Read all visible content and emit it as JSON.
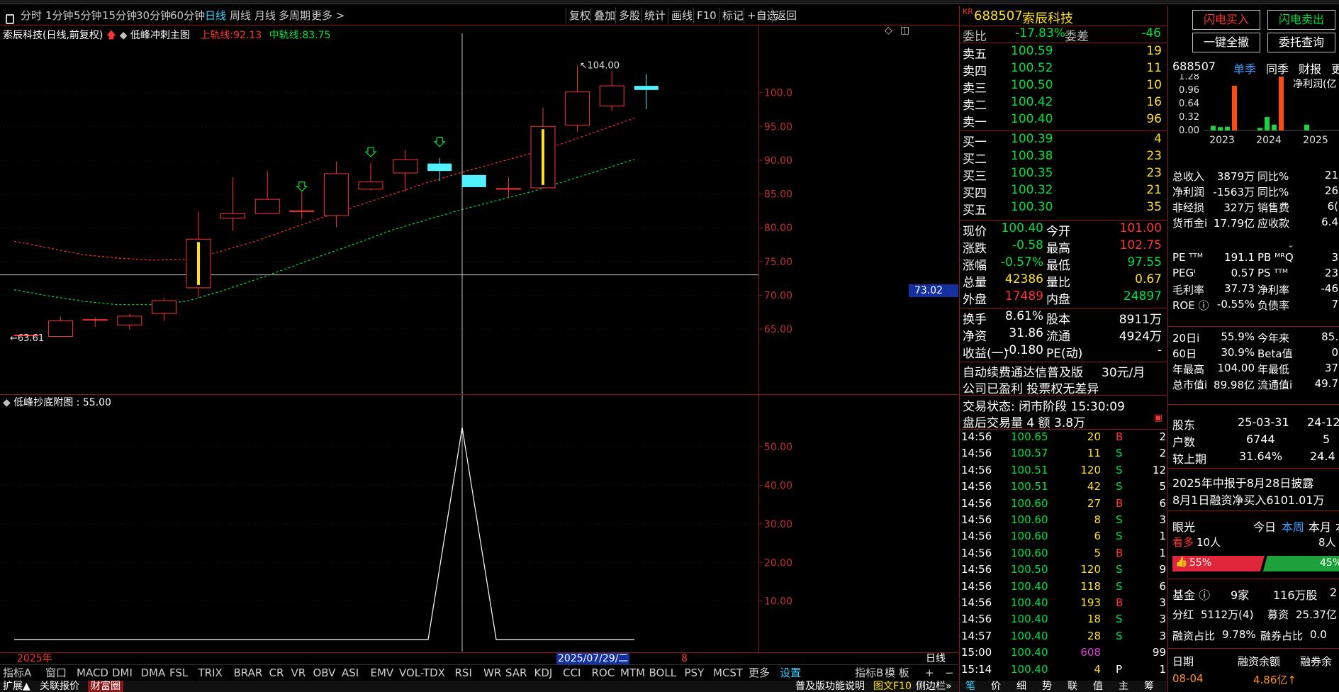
{
  "toolbar": {
    "items": [
      "分时",
      "1分钟",
      "5分钟",
      "15分钟",
      "30分钟",
      "60分钟",
      "日线",
      "周线",
      "月线",
      "多周期",
      "更多 >"
    ],
    "active": "日线",
    "right": [
      "复权",
      "叠加",
      "多股",
      "统计",
      "画线",
      "F10",
      "标记",
      "+自选",
      "返回"
    ]
  },
  "chart": {
    "title": "索辰科技(日线,前复权)",
    "indicator": "低峰冲刺主图",
    "upper_label": "上轨线:",
    "upper_value": "92.13",
    "mid_label": "中轨线:",
    "mid_value": "83.75",
    "high_marker": "104.00",
    "low_marker": "63.61",
    "crosshair_value": "73.02",
    "year_label": "2025年",
    "crosshair_date": "2025/07/29/二",
    "right_tick": "8",
    "sub_title": "低峰抄底附图 : 55.00",
    "period": "日线",
    "price_ticks": [
      "100.0",
      "95.00",
      "90.00",
      "85.00",
      "80.00",
      "75.00",
      "70.00",
      "65.00"
    ],
    "sub_ticks": [
      "50.00",
      "40.00",
      "30.00",
      "20.00",
      "10.00"
    ]
  },
  "chart_data": {
    "type": "candlestick",
    "candles": [
      {
        "o": 64.0,
        "h": 64.3,
        "l": 63.6,
        "c": 64.1
      },
      {
        "o": 63.9,
        "h": 66.8,
        "l": 63.9,
        "c": 66.2
      },
      {
        "o": 66.4,
        "h": 66.7,
        "l": 65.3,
        "c": 66.4
      },
      {
        "o": 65.6,
        "h": 67.2,
        "l": 64.9,
        "c": 66.9
      },
      {
        "o": 67.3,
        "h": 69.6,
        "l": 66.2,
        "c": 69.2
      },
      {
        "o": 71.1,
        "h": 82.4,
        "l": 69.6,
        "c": 78.3
      },
      {
        "o": 81.4,
        "h": 87.5,
        "l": 79.5,
        "c": 82.1
      },
      {
        "o": 82.1,
        "h": 88.4,
        "l": 82.1,
        "c": 84.2
      },
      {
        "o": 82.5,
        "h": 85.3,
        "l": 81.3,
        "c": 82.5
      },
      {
        "o": 81.8,
        "h": 89.8,
        "l": 80.1,
        "c": 88.0
      },
      {
        "o": 85.7,
        "h": 89.6,
        "l": 85.5,
        "c": 86.8
      },
      {
        "o": 88.1,
        "h": 91.5,
        "l": 85.3,
        "c": 90.1
      },
      {
        "o": 89.5,
        "h": 90.3,
        "l": 86.9,
        "c": 88.4
      },
      {
        "o": 87.8,
        "h": 87.8,
        "l": 86.0,
        "c": 86.0
      },
      {
        "o": 85.8,
        "h": 87.5,
        "l": 84.5,
        "c": 85.8
      },
      {
        "o": 85.9,
        "h": 97.8,
        "l": 85.9,
        "c": 95.0
      },
      {
        "o": 95.2,
        "h": 104.0,
        "l": 94.2,
        "c": 100.1
      },
      {
        "o": 98.0,
        "h": 103.2,
        "l": 97.3,
        "c": 101.0
      },
      {
        "o": 101.0,
        "h": 102.75,
        "l": 97.55,
        "c": 100.4
      }
    ],
    "upper_band": [
      78.0,
      77.0,
      76.0,
      75.5,
      75.2,
      75.3,
      76.5,
      78.0,
      79.8,
      81.6,
      83.3,
      85.0,
      86.7,
      88.2,
      89.6,
      91.0,
      92.6,
      94.4,
      96.2
    ],
    "mid_band": [
      70.8,
      69.9,
      69.1,
      68.6,
      68.6,
      69.1,
      70.6,
      72.3,
      74.1,
      76.0,
      77.8,
      79.7,
      81.2,
      82.7,
      84.0,
      85.3,
      86.9,
      88.5,
      90.1
    ],
    "sub_series": [
      0,
      0,
      0,
      0,
      0,
      0,
      0,
      0,
      0,
      0,
      0,
      0,
      0,
      55.0,
      0,
      0,
      0,
      0,
      0
    ],
    "price_range": [
      62,
      108
    ],
    "sub_range": [
      0,
      60
    ]
  },
  "quote": {
    "code_prefix": "KR",
    "code": "688507",
    "name": "索辰科技",
    "weibi_label": "委比",
    "weibi": "-17.83%",
    "weicha_label": "委差",
    "weicha": "-46",
    "sells": [
      {
        "label": "卖五",
        "price": "100.59",
        "vol": "19"
      },
      {
        "label": "卖四",
        "price": "100.52",
        "vol": "11"
      },
      {
        "label": "卖三",
        "price": "100.50",
        "vol": "10"
      },
      {
        "label": "卖二",
        "price": "100.42",
        "vol": "16"
      },
      {
        "label": "卖一",
        "price": "100.40",
        "vol": "96"
      }
    ],
    "buys": [
      {
        "label": "买一",
        "price": "100.39",
        "vol": "4"
      },
      {
        "label": "买二",
        "price": "100.38",
        "vol": "23"
      },
      {
        "label": "买三",
        "price": "100.35",
        "vol": "23"
      },
      {
        "label": "买四",
        "price": "100.32",
        "vol": "21"
      },
      {
        "label": "买五",
        "price": "100.30",
        "vol": "35"
      }
    ],
    "stats": [
      {
        "l1": "现价",
        "v1": "100.40",
        "l2": "今开",
        "v2": "101.00"
      },
      {
        "l1": "涨跌",
        "v1": "-0.58",
        "l2": "最高",
        "v2": "102.75"
      },
      {
        "l1": "涨幅",
        "v1": "-0.57%",
        "l2": "最低",
        "v2": "97.55"
      },
      {
        "l1": "总量",
        "v1": "42386",
        "l2": "量比",
        "v2": "0.67"
      },
      {
        "l1": "外盘",
        "v1": "17489",
        "l2": "内盘",
        "v2": "24897"
      }
    ],
    "stats2": [
      {
        "l1": "换手",
        "v1": "8.61%",
        "l2": "股本",
        "v2": "8911万"
      },
      {
        "l1": "净资",
        "v1": "31.86",
        "l2": "流通",
        "v2": "4924万"
      },
      {
        "l1": "收益(一)",
        "v1": "-0.180",
        "l2": "PE(动)",
        "v2": "-"
      }
    ],
    "notice1": "自动续费通达信普及版",
    "notice1_price": "30元/月",
    "notice2": "公司已盈利 投票权无差异",
    "trade_status": "交易状态: 闭市阶段 15:30:09",
    "after_hours": "盘后交易量 4 额 3.8万",
    "ticks": [
      {
        "t": "14:56",
        "p": "100.65",
        "v": "20",
        "s": "B",
        "n": "2"
      },
      {
        "t": "14:56",
        "p": "100.57",
        "v": "11",
        "s": "S",
        "n": "2"
      },
      {
        "t": "14:56",
        "p": "100.51",
        "v": "120",
        "s": "S",
        "n": "12"
      },
      {
        "t": "14:56",
        "p": "100.51",
        "v": "42",
        "s": "S",
        "n": "5"
      },
      {
        "t": "14:56",
        "p": "100.60",
        "v": "27",
        "s": "B",
        "n": "6"
      },
      {
        "t": "14:56",
        "p": "100.60",
        "v": "8",
        "s": "S",
        "n": "3"
      },
      {
        "t": "14:56",
        "p": "100.60",
        "v": "6",
        "s": "S",
        "n": "1"
      },
      {
        "t": "14:56",
        "p": "100.60",
        "v": "5",
        "s": "B",
        "n": "1"
      },
      {
        "t": "14:56",
        "p": "100.50",
        "v": "120",
        "s": "S",
        "n": "9"
      },
      {
        "t": "14:56",
        "p": "100.40",
        "v": "118",
        "s": "S",
        "n": "6"
      },
      {
        "t": "14:56",
        "p": "100.40",
        "v": "193",
        "s": "B",
        "n": "3"
      },
      {
        "t": "14:56",
        "p": "100.40",
        "v": "18",
        "s": "S",
        "n": "3"
      },
      {
        "t": "14:57",
        "p": "100.40",
        "v": "28",
        "s": "S",
        "n": "3"
      },
      {
        "t": "15:00",
        "p": "100.40",
        "v": "608",
        "s": "",
        "n": "99"
      },
      {
        "t": "15:14",
        "p": "100.40",
        "v": "4",
        "s": "P",
        "n": "1"
      }
    ],
    "tabs": [
      "笔",
      "价",
      "细",
      "势",
      "联",
      "值",
      "主",
      "筹"
    ]
  },
  "f10": {
    "btn_flash_buy": "闪电买入",
    "btn_flash_sell": "闪电卖出",
    "btn_clear": "一键全撤",
    "btn_orders": "委托查询",
    "code": "688507",
    "tabs": [
      "单季",
      "同季",
      "财报",
      "更"
    ],
    "net_profit_label": "净利润(亿",
    "bar_ticks": [
      "1.28",
      "0.96",
      "0.64",
      "0.32",
      "0.00"
    ],
    "bar_years": [
      "2023",
      "2024",
      "2025"
    ],
    "bar_data": [
      {
        "name": "2023",
        "values": [
          0.11,
          0.08,
          0.09,
          1.06
        ]
      },
      {
        "name": "2024",
        "values": [
          0.06,
          0.32,
          0.14,
          1.28
        ]
      },
      {
        "name": "2025",
        "values": [
          0.14,
          0.0,
          0.0,
          0.0
        ]
      }
    ],
    "fin": [
      {
        "l1": "总收入",
        "v1": "3879万",
        "l2": "同比%",
        "v2": "21"
      },
      {
        "l1": "净利润",
        "v1": "-1563万",
        "l2": "同比%",
        "v2": "26"
      },
      {
        "l1": "非经损",
        "v1": "327万",
        "l2": "销售费",
        "v2": "6("
      },
      {
        "l1": "货币金i",
        "v1": "17.79亿",
        "l2": "应收款",
        "v2": "6.4"
      }
    ],
    "val": [
      {
        "l1": "PE ᵀᵀᴹ",
        "v1": "191.1",
        "l2": "PB ᴹᴿQ",
        "v2": "3"
      },
      {
        "l1": "PEGⁱ",
        "v1": "0.57",
        "l2": "PS ᵀᵀᴹ",
        "v2": "23"
      },
      {
        "l1": "毛利率",
        "v1": "37.73",
        "l2": "净利率",
        "v2": "-46"
      },
      {
        "l1": "ROE ⓘ",
        "v1": "-0.55%",
        "l2": "负债率",
        "v2": "7"
      }
    ],
    "perf": [
      {
        "l1": "20日i",
        "v1": "55.9%",
        "l2": "今年来",
        "v2": "85."
      },
      {
        "l1": "60日",
        "v1": "30.9%",
        "l2": "Beta值",
        "v2": "0"
      },
      {
        "l1": "年最高",
        "v1": "104.00",
        "l2": "年最低",
        "v2": "37"
      },
      {
        "l1": "总市值i",
        "v1": "89.98亿",
        "l2": "流通值i",
        "v2": "49.7"
      }
    ],
    "holders_label": "股东",
    "holders_d1": "25-03-31",
    "holders_d2": "24-12",
    "hu_label": "户数",
    "hu_v1": "6744",
    "hu_v2": "5",
    "cmp_label": "较上期",
    "cmp_v1": "31.64%",
    "cmp_v2": "24.4",
    "report_note": "2025年中报于8月28日披露",
    "margin_note": "8月1日融资净买入6101.01万",
    "eye_label": "眼光",
    "eye_tabs": [
      "今日",
      "本周",
      "本月",
      "本"
    ],
    "bull_label": "看多",
    "bull_count": "10人",
    "bear_count": "8人",
    "bull_pct": "55%",
    "bear_pct": "45%",
    "fund_label": "基金 ⓘ",
    "fund_count": "9家",
    "fund_shares": "116万股",
    "fund_v": "2",
    "div_label": "分红",
    "div_v": "5112万(4)",
    "raise_label": "募资",
    "raise_v": "25.37亿",
    "margin_ratio_label": "融资占比",
    "margin_ratio": "9.78%",
    "short_ratio_label": "融券占比",
    "short_ratio": "0.0",
    "date_label": "日期",
    "margin_bal_label": "融资余额",
    "short_bal_label": "融券余",
    "date_v": "08-04",
    "margin_bal_v": "4.86亿↑"
  },
  "bottom": {
    "items": [
      "指标A",
      "窗口",
      "MACD",
      "DMI",
      "DMA",
      "FSL",
      "TRIX",
      "BRAR",
      "CR",
      "VR",
      "OBV",
      "ASI",
      "EMV",
      "VOL-TDX",
      "RSI",
      "WR",
      "SAR",
      "KDJ",
      "CCI",
      "ROC",
      "MTM",
      "BOLL",
      "PSY",
      "MCST",
      "更多",
      "设置"
    ],
    "right": [
      "指标B",
      "模 板"
    ],
    "plus": "+",
    "minus": "−"
  },
  "status": {
    "items": [
      "扩展▲",
      "关联报价",
      "财富圈"
    ],
    "right": [
      "普及版功能说明",
      "图文F10",
      "侧边栏»"
    ]
  },
  "colors": {
    "up": "#ff3333",
    "down": "#00e040",
    "border": "#8a1a1a",
    "accent": "#35d0ff",
    "yellow": "#ffe020"
  }
}
